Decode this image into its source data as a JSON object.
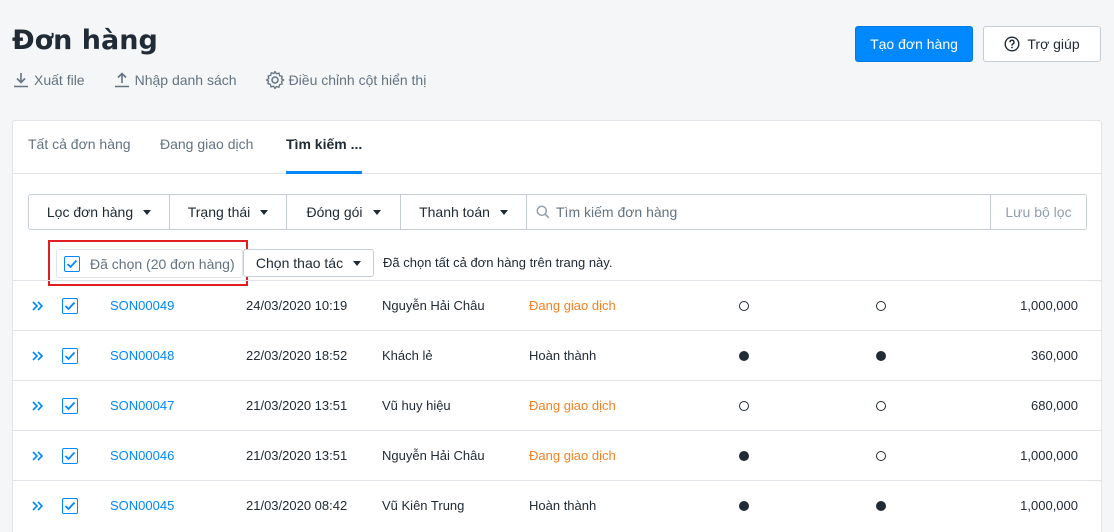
{
  "header": {
    "title": "Đơn hàng",
    "actions": [
      {
        "label": "Xuất file",
        "icon": "download-icon"
      },
      {
        "label": "Nhập danh sách",
        "icon": "upload-icon"
      },
      {
        "label": "Điều chỉnh cột hiển thị",
        "icon": "gear-icon"
      }
    ],
    "create_button": "Tạo đơn hàng",
    "help_button": "Trợ giúp"
  },
  "tabs": [
    {
      "label": "Tất cả đơn hàng",
      "active": false
    },
    {
      "label": "Đang giao dịch",
      "active": false
    },
    {
      "label": "Tìm kiếm ...",
      "active": true
    }
  ],
  "filters": {
    "buttons": [
      "Lọc đơn hàng",
      "Trạng thái",
      "Đóng gói",
      "Thanh toán"
    ],
    "search_placeholder": "Tìm kiếm đơn hàng",
    "save_label": "Lưu bộ lọc"
  },
  "bulk": {
    "selected_label": "Đã chọn (20 đơn hàng)",
    "action_label": "Chọn thao tác",
    "note": "Đã chọn tất cả đơn hàng trên trang này."
  },
  "orders": [
    {
      "code": "SON00049",
      "date": "24/03/2020 10:19",
      "customer": "Nguyễn Hải Châu",
      "status": "Đang giao dịch",
      "packed": false,
      "paid": false,
      "total": "1,000,000"
    },
    {
      "code": "SON00048",
      "date": "22/03/2020 18:52",
      "customer": "Khách lẻ",
      "status": "Hoàn thành",
      "packed": true,
      "paid": true,
      "total": "360,000"
    },
    {
      "code": "SON00047",
      "date": "21/03/2020 13:51",
      "customer": "Vũ huy hiệu",
      "status": "Đang giao dịch",
      "packed": false,
      "paid": false,
      "total": "680,000"
    },
    {
      "code": "SON00046",
      "date": "21/03/2020 13:51",
      "customer": "Nguyễn Hải Châu",
      "status": "Đang giao dịch",
      "packed": true,
      "paid": false,
      "total": "1,000,000"
    },
    {
      "code": "SON00045",
      "date": "21/03/2020 08:42",
      "customer": "Vũ Kiên Trung",
      "status": "Hoàn thành",
      "packed": true,
      "paid": true,
      "total": "1,000,000"
    }
  ],
  "colors": {
    "accent": "#0088ff",
    "status_in_progress": "#f5801f",
    "status_done": "#212b35",
    "highlight": "#e02020"
  }
}
